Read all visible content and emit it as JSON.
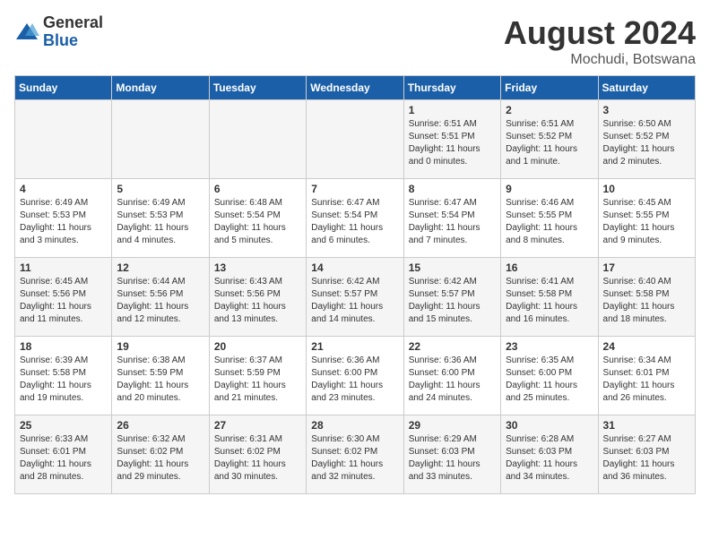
{
  "logo": {
    "general": "General",
    "blue": "Blue"
  },
  "title": "August 2024",
  "location": "Mochudi, Botswana",
  "days_of_week": [
    "Sunday",
    "Monday",
    "Tuesday",
    "Wednesday",
    "Thursday",
    "Friday",
    "Saturday"
  ],
  "weeks": [
    [
      {
        "day": "",
        "info": ""
      },
      {
        "day": "",
        "info": ""
      },
      {
        "day": "",
        "info": ""
      },
      {
        "day": "",
        "info": ""
      },
      {
        "day": "1",
        "info": "Sunrise: 6:51 AM\nSunset: 5:51 PM\nDaylight: 11 hours and 0 minutes."
      },
      {
        "day": "2",
        "info": "Sunrise: 6:51 AM\nSunset: 5:52 PM\nDaylight: 11 hours and 1 minute."
      },
      {
        "day": "3",
        "info": "Sunrise: 6:50 AM\nSunset: 5:52 PM\nDaylight: 11 hours and 2 minutes."
      }
    ],
    [
      {
        "day": "4",
        "info": "Sunrise: 6:49 AM\nSunset: 5:53 PM\nDaylight: 11 hours and 3 minutes."
      },
      {
        "day": "5",
        "info": "Sunrise: 6:49 AM\nSunset: 5:53 PM\nDaylight: 11 hours and 4 minutes."
      },
      {
        "day": "6",
        "info": "Sunrise: 6:48 AM\nSunset: 5:54 PM\nDaylight: 11 hours and 5 minutes."
      },
      {
        "day": "7",
        "info": "Sunrise: 6:47 AM\nSunset: 5:54 PM\nDaylight: 11 hours and 6 minutes."
      },
      {
        "day": "8",
        "info": "Sunrise: 6:47 AM\nSunset: 5:54 PM\nDaylight: 11 hours and 7 minutes."
      },
      {
        "day": "9",
        "info": "Sunrise: 6:46 AM\nSunset: 5:55 PM\nDaylight: 11 hours and 8 minutes."
      },
      {
        "day": "10",
        "info": "Sunrise: 6:45 AM\nSunset: 5:55 PM\nDaylight: 11 hours and 9 minutes."
      }
    ],
    [
      {
        "day": "11",
        "info": "Sunrise: 6:45 AM\nSunset: 5:56 PM\nDaylight: 11 hours and 11 minutes."
      },
      {
        "day": "12",
        "info": "Sunrise: 6:44 AM\nSunset: 5:56 PM\nDaylight: 11 hours and 12 minutes."
      },
      {
        "day": "13",
        "info": "Sunrise: 6:43 AM\nSunset: 5:56 PM\nDaylight: 11 hours and 13 minutes."
      },
      {
        "day": "14",
        "info": "Sunrise: 6:42 AM\nSunset: 5:57 PM\nDaylight: 11 hours and 14 minutes."
      },
      {
        "day": "15",
        "info": "Sunrise: 6:42 AM\nSunset: 5:57 PM\nDaylight: 11 hours and 15 minutes."
      },
      {
        "day": "16",
        "info": "Sunrise: 6:41 AM\nSunset: 5:58 PM\nDaylight: 11 hours and 16 minutes."
      },
      {
        "day": "17",
        "info": "Sunrise: 6:40 AM\nSunset: 5:58 PM\nDaylight: 11 hours and 18 minutes."
      }
    ],
    [
      {
        "day": "18",
        "info": "Sunrise: 6:39 AM\nSunset: 5:58 PM\nDaylight: 11 hours and 19 minutes."
      },
      {
        "day": "19",
        "info": "Sunrise: 6:38 AM\nSunset: 5:59 PM\nDaylight: 11 hours and 20 minutes."
      },
      {
        "day": "20",
        "info": "Sunrise: 6:37 AM\nSunset: 5:59 PM\nDaylight: 11 hours and 21 minutes."
      },
      {
        "day": "21",
        "info": "Sunrise: 6:36 AM\nSunset: 6:00 PM\nDaylight: 11 hours and 23 minutes."
      },
      {
        "day": "22",
        "info": "Sunrise: 6:36 AM\nSunset: 6:00 PM\nDaylight: 11 hours and 24 minutes."
      },
      {
        "day": "23",
        "info": "Sunrise: 6:35 AM\nSunset: 6:00 PM\nDaylight: 11 hours and 25 minutes."
      },
      {
        "day": "24",
        "info": "Sunrise: 6:34 AM\nSunset: 6:01 PM\nDaylight: 11 hours and 26 minutes."
      }
    ],
    [
      {
        "day": "25",
        "info": "Sunrise: 6:33 AM\nSunset: 6:01 PM\nDaylight: 11 hours and 28 minutes."
      },
      {
        "day": "26",
        "info": "Sunrise: 6:32 AM\nSunset: 6:02 PM\nDaylight: 11 hours and 29 minutes."
      },
      {
        "day": "27",
        "info": "Sunrise: 6:31 AM\nSunset: 6:02 PM\nDaylight: 11 hours and 30 minutes."
      },
      {
        "day": "28",
        "info": "Sunrise: 6:30 AM\nSunset: 6:02 PM\nDaylight: 11 hours and 32 minutes."
      },
      {
        "day": "29",
        "info": "Sunrise: 6:29 AM\nSunset: 6:03 PM\nDaylight: 11 hours and 33 minutes."
      },
      {
        "day": "30",
        "info": "Sunrise: 6:28 AM\nSunset: 6:03 PM\nDaylight: 11 hours and 34 minutes."
      },
      {
        "day": "31",
        "info": "Sunrise: 6:27 AM\nSunset: 6:03 PM\nDaylight: 11 hours and 36 minutes."
      }
    ]
  ]
}
